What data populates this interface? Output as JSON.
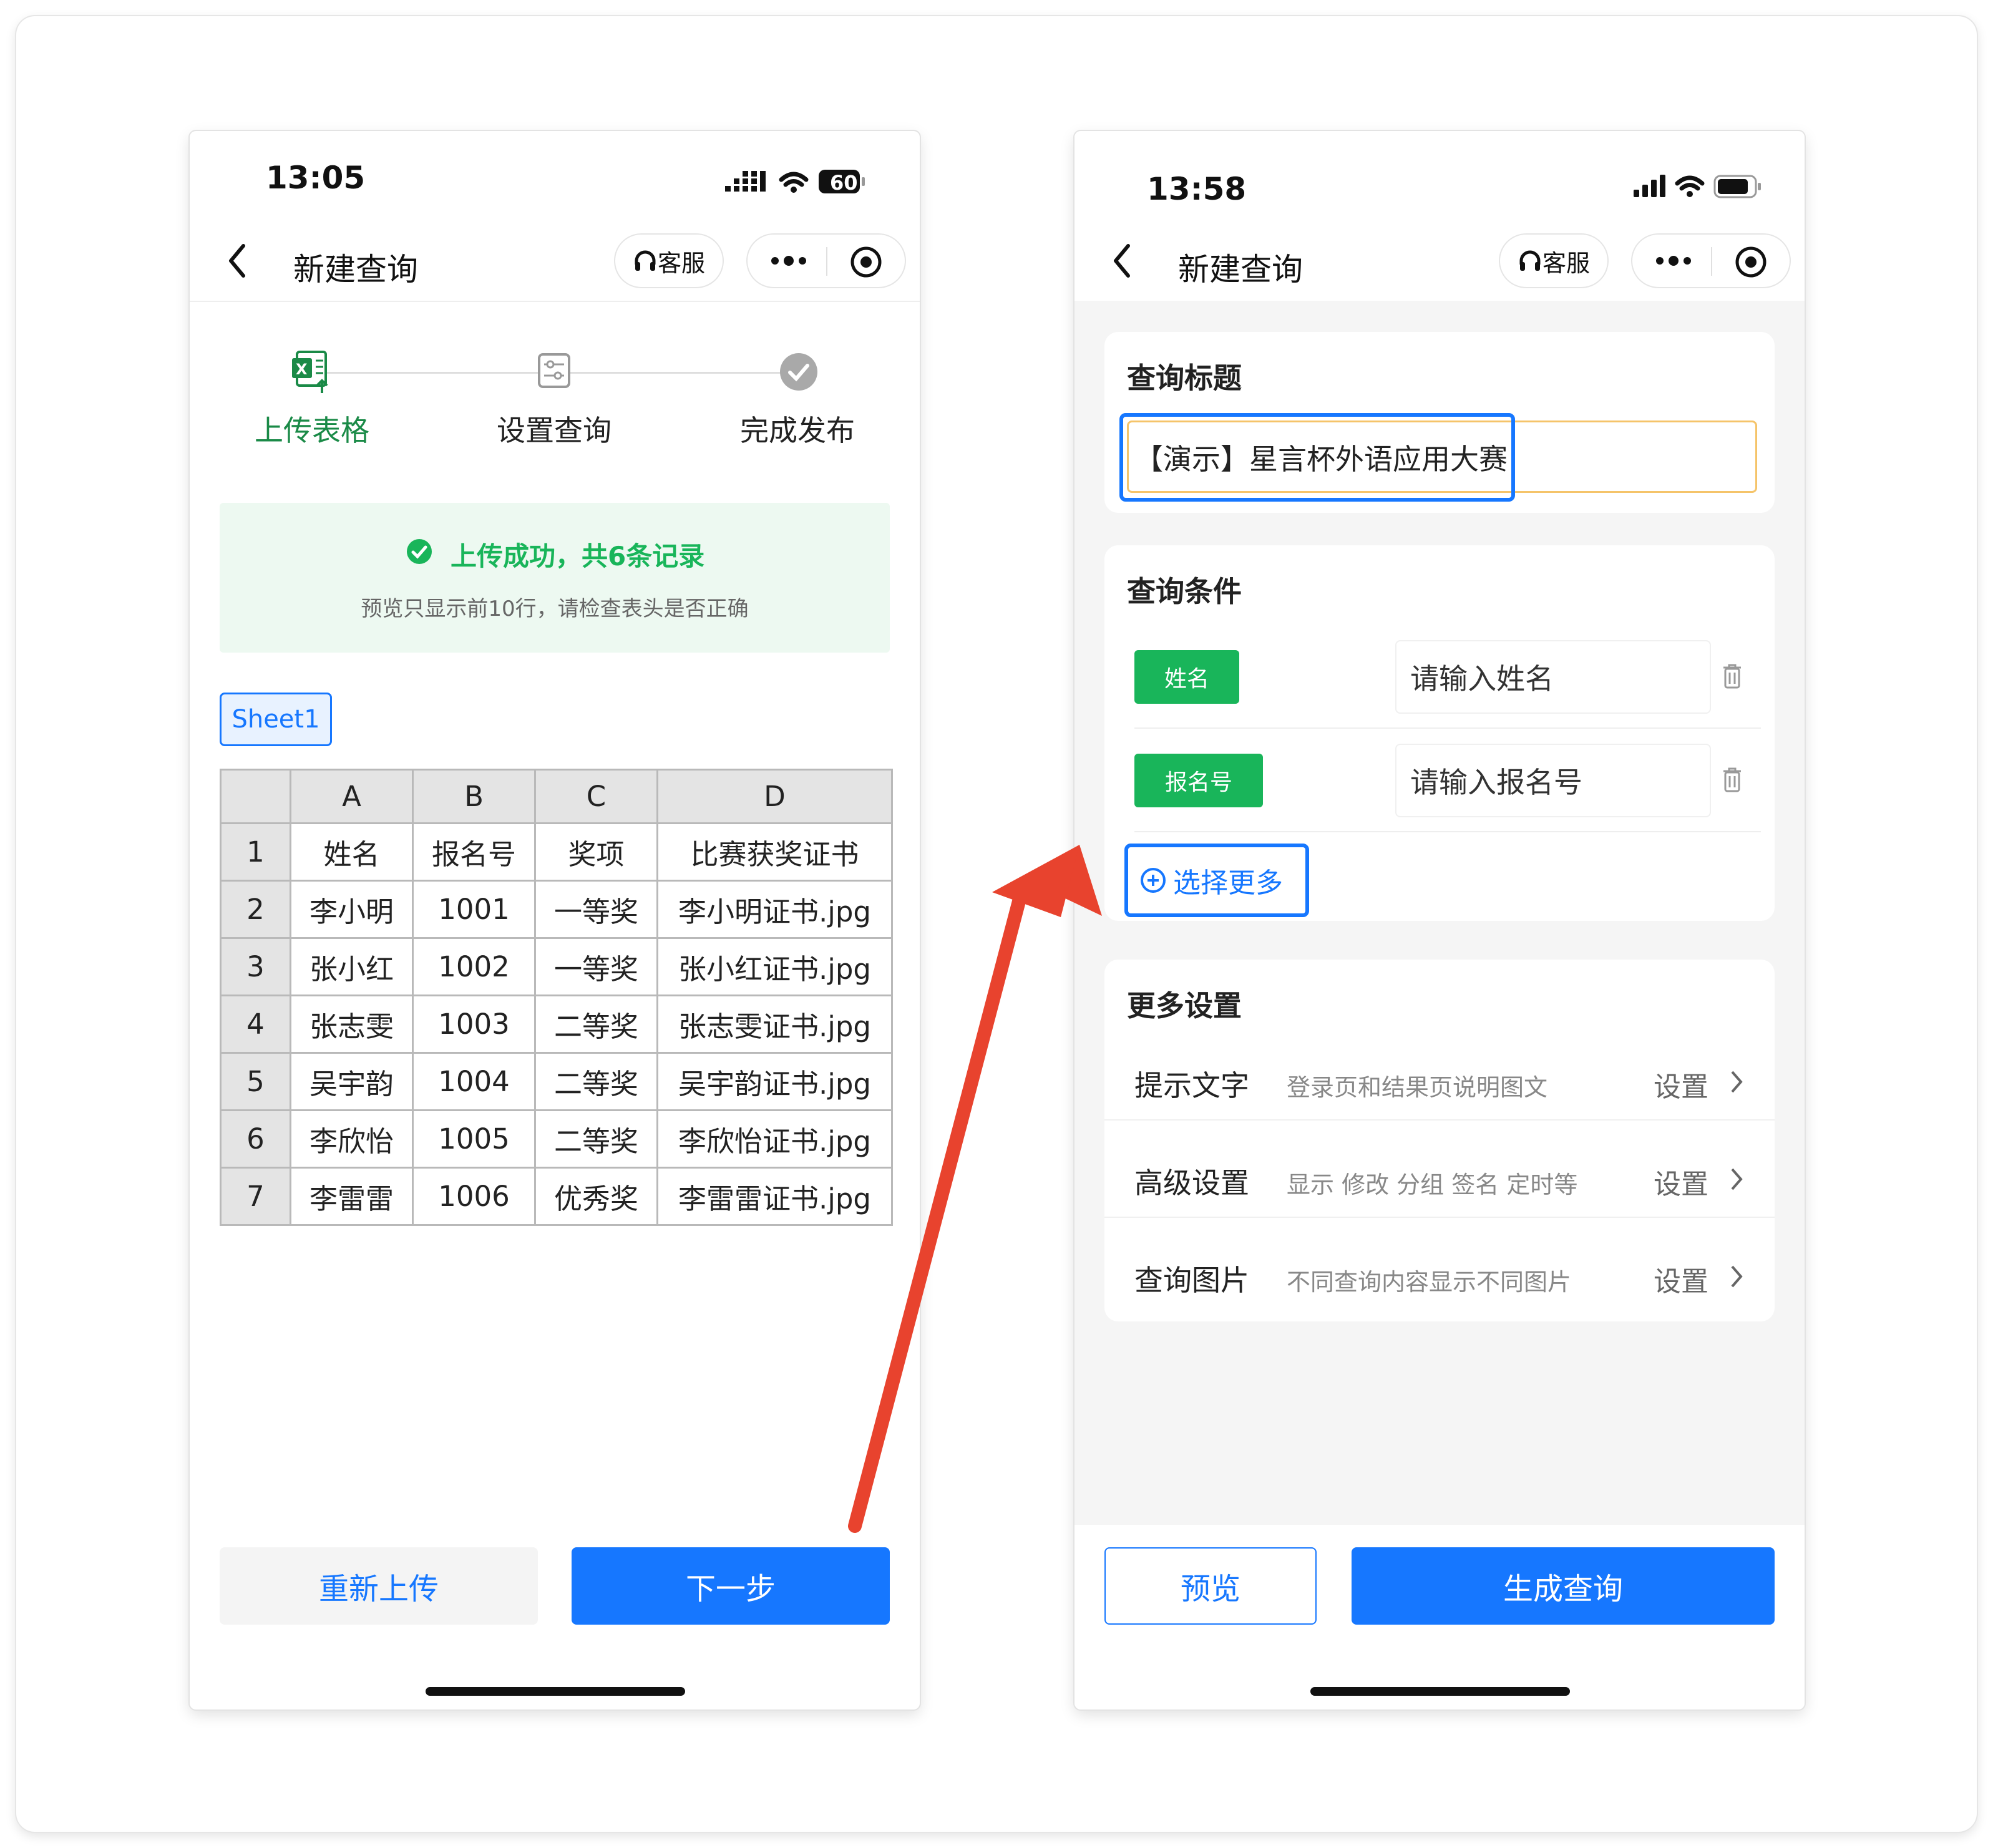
{
  "left": {
    "status": {
      "time": "13:05",
      "battery": "60"
    },
    "nav": {
      "title": "新建查询",
      "service": "客服"
    },
    "steps": [
      "上传表格",
      "设置查询",
      "完成发布"
    ],
    "notice": {
      "title": "上传成功，共6条记录",
      "subtitle": "预览只显示前10行，请检查表头是否正确"
    },
    "sheet_tab": "Sheet1",
    "table": {
      "columns": [
        "A",
        "B",
        "C",
        "D"
      ],
      "rows": [
        [
          "1",
          "姓名",
          "报名号",
          "奖项",
          "比赛获奖证书"
        ],
        [
          "2",
          "李小明",
          "1001",
          "一等奖",
          "李小明证书.jpg"
        ],
        [
          "3",
          "张小红",
          "1002",
          "一等奖",
          "张小红证书.jpg"
        ],
        [
          "4",
          "张志雯",
          "1003",
          "二等奖",
          "张志雯证书.jpg"
        ],
        [
          "5",
          "吴宇韵",
          "1004",
          "二等奖",
          "吴宇韵证书.jpg"
        ],
        [
          "6",
          "李欣怡",
          "1005",
          "二等奖",
          "李欣怡证书.jpg"
        ],
        [
          "7",
          "李雷雷",
          "1006",
          "优秀奖",
          "李雷雷证书.jpg"
        ]
      ]
    },
    "buttons": {
      "reupload": "重新上传",
      "next": "下一步"
    }
  },
  "right": {
    "status": {
      "time": "13:58"
    },
    "nav": {
      "title": "新建查询",
      "service": "客服"
    },
    "query_title": {
      "label": "查询标题",
      "value": "【演示】星言杯外语应用大赛"
    },
    "conditions": {
      "label": "查询条件",
      "items": [
        {
          "tag": "姓名",
          "placeholder": "请输入姓名"
        },
        {
          "tag": "报名号",
          "placeholder": "请输入报名号"
        }
      ],
      "more": "选择更多"
    },
    "more_settings": {
      "label": "更多设置",
      "items": [
        {
          "label": "提示文字",
          "desc": "登录页和结果页说明图文",
          "action": "设置"
        },
        {
          "label": "高级设置",
          "desc": "显示 修改 分组 签名 定时等",
          "action": "设置"
        },
        {
          "label": "查询图片",
          "desc": "不同查询内容显示不同图片",
          "action": "设置"
        }
      ]
    },
    "buttons": {
      "preview": "预览",
      "generate": "生成查询"
    }
  },
  "colors": {
    "primary": "#1677ff",
    "success": "#19b55a",
    "arrow": "#e8432e",
    "highlight": "#1677ff"
  }
}
